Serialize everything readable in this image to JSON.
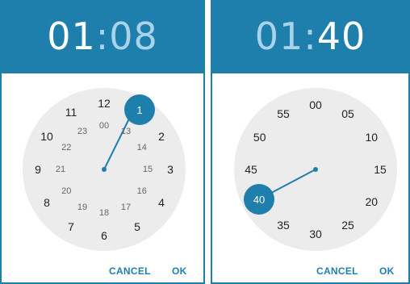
{
  "pickers": [
    {
      "hour": "01",
      "separator": ":",
      "minute": "08",
      "selected_value": "1",
      "outer_numbers": [
        "12",
        "1",
        "2",
        "3",
        "4",
        "5",
        "6",
        "7",
        "8",
        "9",
        "10",
        "11"
      ],
      "inner_numbers": [
        "00",
        "13",
        "14",
        "15",
        "16",
        "17",
        "18",
        "19",
        "20",
        "21",
        "22",
        "23"
      ],
      "cancel_label": "CANCEL",
      "ok_label": "OK"
    },
    {
      "hour": "01",
      "separator": ":",
      "minute": "40",
      "selected_value": "40",
      "outer_numbers": [
        "00",
        "05",
        "10",
        "15",
        "20",
        "25",
        "30",
        "35",
        "40",
        "45",
        "50",
        "55"
      ],
      "cancel_label": "CANCEL",
      "ok_label": "OK"
    }
  ],
  "colors": {
    "accent": "#1f7fac",
    "header_inactive_text": "#a9d3ea",
    "clock_face": "#ececec"
  }
}
